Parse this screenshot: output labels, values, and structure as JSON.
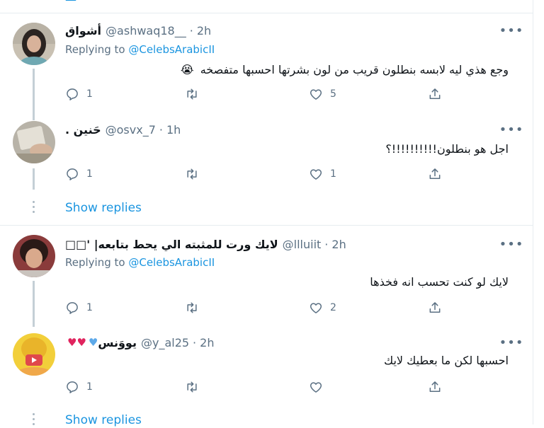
{
  "top_partial": {
    "text": "—"
  },
  "more_label": "•••",
  "tweets": [
    {
      "name": "أشواق",
      "handle": "@ashwaq18__",
      "time": "2h",
      "replying_prefix": "Replying to",
      "replying_to": "@CelebsArabicII",
      "text": "وجع هذي ليه لابسه بنطلون قريب من لون بشرتها احسبها متفصخه",
      "emoji": "😭",
      "reply_count": "1",
      "retweet_count": "",
      "like_count": "5"
    },
    {
      "name": "حَنين .",
      "handle": "@osvx_7",
      "time": "1h",
      "text": "اجل هو بنطلون!!!!!!!!!!؟",
      "reply_count": "1",
      "retweet_count": "",
      "like_count": "1"
    },
    {
      "name": "لايك ورت للمثبته الي يحط بتابعه| '□□",
      "handle": "@llluiit",
      "time": "2h",
      "replying_prefix": "Replying to",
      "replying_to": "@CelebsArabicII",
      "text": "لايك لو كنت تحسب انه فخذها",
      "reply_count": "1",
      "retweet_count": "",
      "like_count": "2"
    },
    {
      "name": "يووَنس",
      "handle": "@y_al25",
      "time": "2h",
      "text": "احسبها لكن ما بعطيك لايك",
      "reply_count": "1",
      "retweet_count": "",
      "like_count": ""
    }
  ],
  "show_replies": [
    "Show replies",
    "Show replies"
  ],
  "colors": {
    "accent": "#1b95e0",
    "secondary_text": "#5b7083",
    "divider": "#e6ecf0",
    "thread_line": "#c4cfd6"
  },
  "icons": {
    "reply": "reply-icon",
    "retweet": "retweet-icon",
    "like": "heart-icon",
    "share": "share-icon",
    "more": "more-icon"
  }
}
